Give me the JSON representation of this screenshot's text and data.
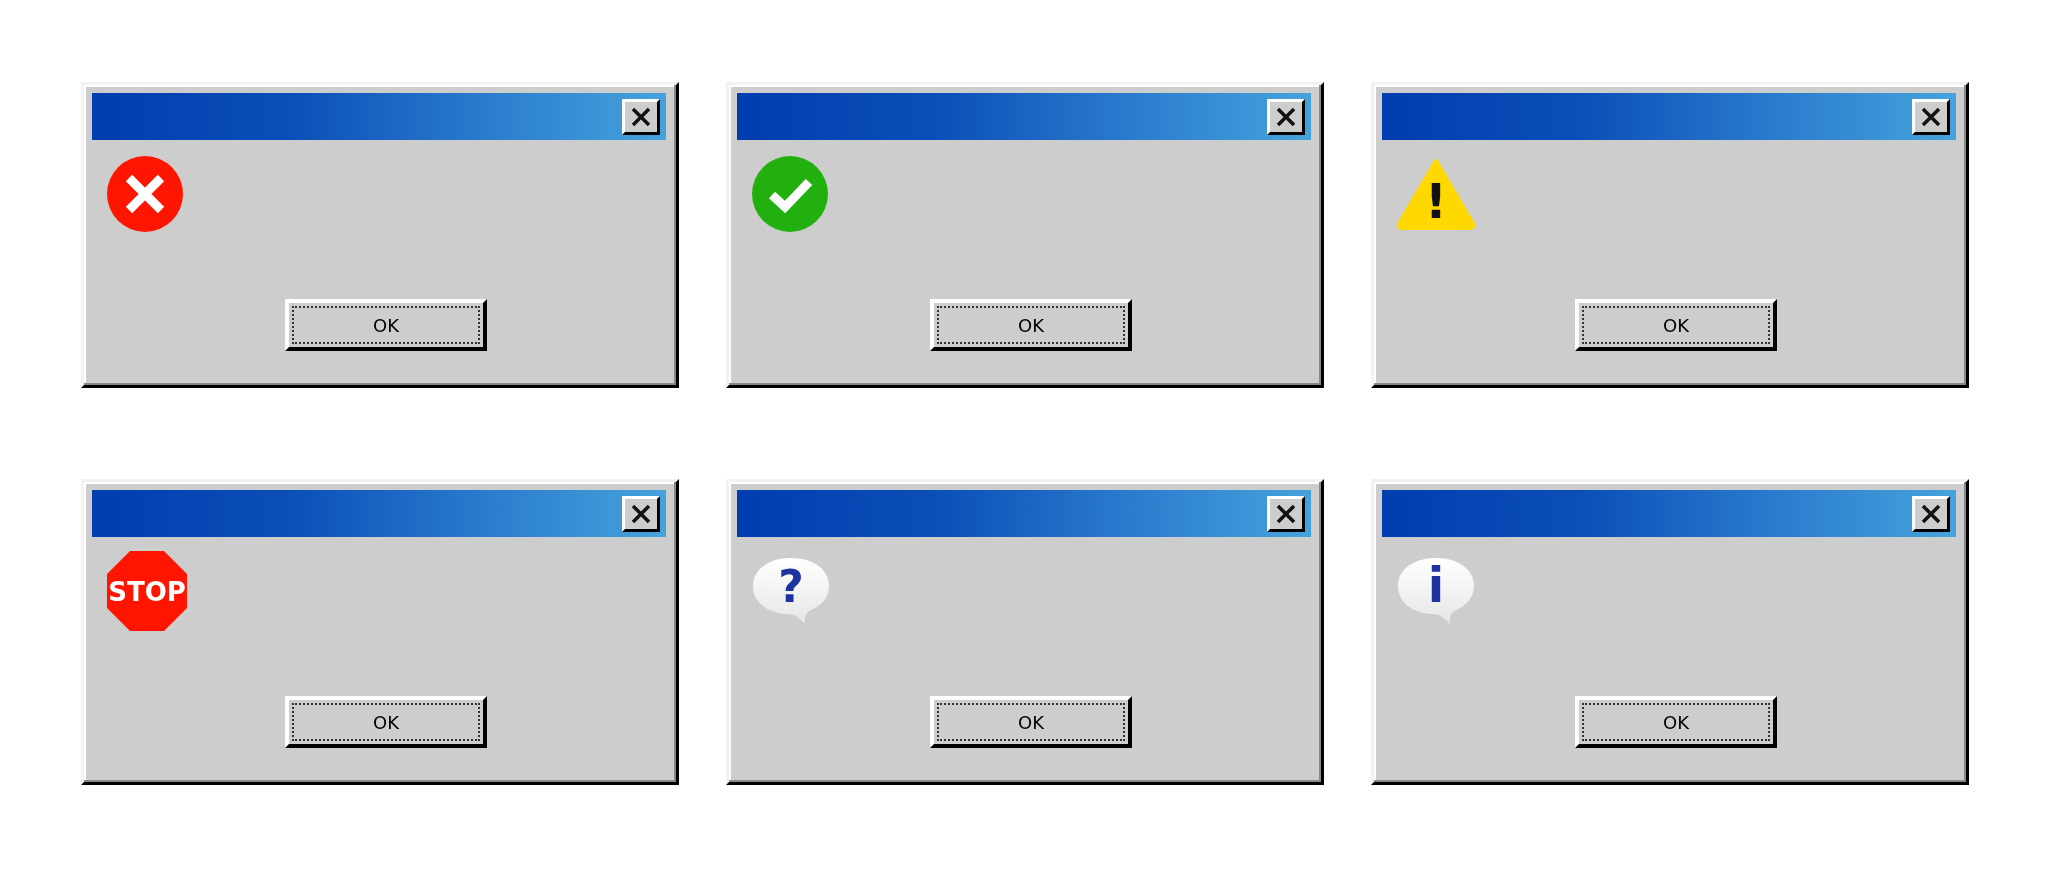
{
  "dialogs": [
    {
      "kind": "error",
      "button": "OK"
    },
    {
      "kind": "success",
      "button": "OK"
    },
    {
      "kind": "warning",
      "icon_text": "!",
      "button": "OK"
    },
    {
      "kind": "stop",
      "icon_text": "STOP",
      "button": "OK"
    },
    {
      "kind": "question",
      "icon_text": "?",
      "button": "OK"
    },
    {
      "kind": "info",
      "icon_text": "i",
      "button": "OK"
    }
  ]
}
